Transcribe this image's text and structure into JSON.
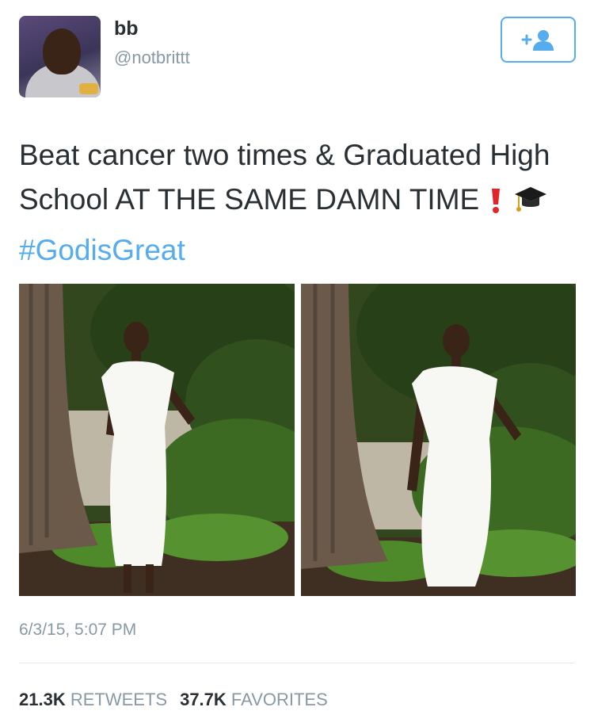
{
  "profile": {
    "display_name": "bb",
    "handle": "@notbrittt",
    "avatar_icon": "profile-photo",
    "follow_icon": "add-user-icon"
  },
  "tweet": {
    "text_main": "Beat cancer two times & Graduated High School AT THE SAME DAMN TIME",
    "emoji_1": "exclamation-icon",
    "emoji_2": "graduation-cap-icon",
    "hashtag": "#GodisGreat"
  },
  "media": {
    "photo_count": 2
  },
  "meta": {
    "timestamp": "6/3/15, 5:07 PM"
  },
  "stats": {
    "retweets_count": "21.3K",
    "retweets_label": "RETWEETS",
    "favorites_count": "37.7K",
    "favorites_label": "FAVORITES"
  },
  "colors": {
    "accent": "#55acee",
    "text": "#292f33",
    "muted": "#8899a6"
  }
}
